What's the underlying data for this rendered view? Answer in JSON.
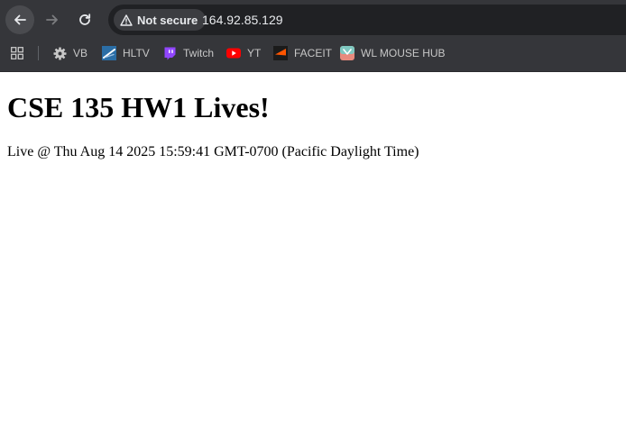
{
  "browser": {
    "omnibox": {
      "security_label": "Not secure",
      "url": "164.92.85.129"
    },
    "bookmarks": [
      {
        "label": "VB",
        "icon": "gear-icon"
      },
      {
        "label": "HLTV",
        "icon": "hltv-icon"
      },
      {
        "label": "Twitch",
        "icon": "twitch-icon"
      },
      {
        "label": "YT",
        "icon": "youtube-icon"
      },
      {
        "label": "FACEIT",
        "icon": "faceit-icon"
      },
      {
        "label": "WL MOUSE HUB",
        "icon": "wlmouse-icon"
      }
    ]
  },
  "page": {
    "title": "CSE 135 HW1 Lives!",
    "live_text": "Live @ Thu Aug 14 2025 15:59:41 GMT-0700 (Pacific Daylight Time)"
  },
  "colors": {
    "chrome_bg": "#35363a",
    "omnibox_bg": "#202124",
    "chrome_text": "#e8eaed",
    "page_bg": "#ffffff"
  }
}
